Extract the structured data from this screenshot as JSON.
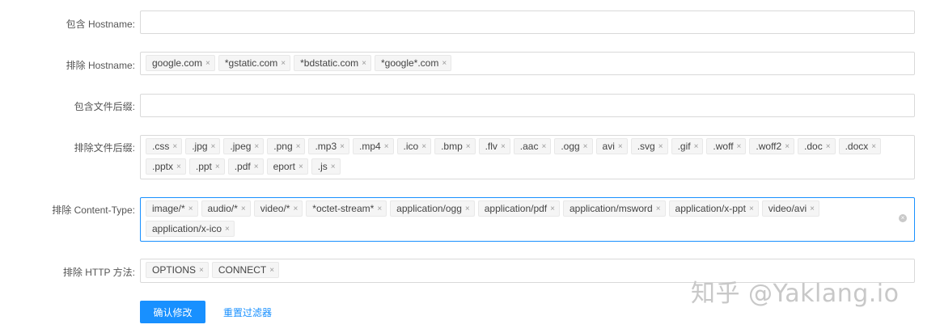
{
  "fields": [
    {
      "label": "包含 Hostname:",
      "tags": []
    },
    {
      "label": "排除 Hostname:",
      "tags": [
        "google.com",
        "*gstatic.com",
        "*bdstatic.com",
        "*google*.com"
      ]
    },
    {
      "label": "包含文件后缀:",
      "tags": []
    },
    {
      "label": "排除文件后缀:",
      "tags": [
        ".css",
        ".jpg",
        ".jpeg",
        ".png",
        ".mp3",
        ".mp4",
        ".ico",
        ".bmp",
        ".flv",
        ".aac",
        ".ogg",
        "avi",
        ".svg",
        ".gif",
        ".woff",
        ".woff2",
        ".doc",
        ".docx",
        ".pptx",
        ".ppt",
        ".pdf",
        "eport",
        ".js"
      ]
    },
    {
      "label": "排除 Content-Type:",
      "tags": [
        "image/*",
        "audio/*",
        "video/*",
        "*octet-stream*",
        "application/ogg",
        "application/pdf",
        "application/msword",
        "application/x-ppt",
        "video/avi",
        "application/x-ico"
      ]
    },
    {
      "label": "排除 HTTP 方法:",
      "tags": [
        "OPTIONS",
        "CONNECT"
      ]
    }
  ],
  "actions": {
    "confirm_label": "确认修改",
    "reset_label": "重置过滤器"
  },
  "watermark": "知乎 @Yaklang.io",
  "tag_close_glyph": "×",
  "clear_glyph": "×"
}
